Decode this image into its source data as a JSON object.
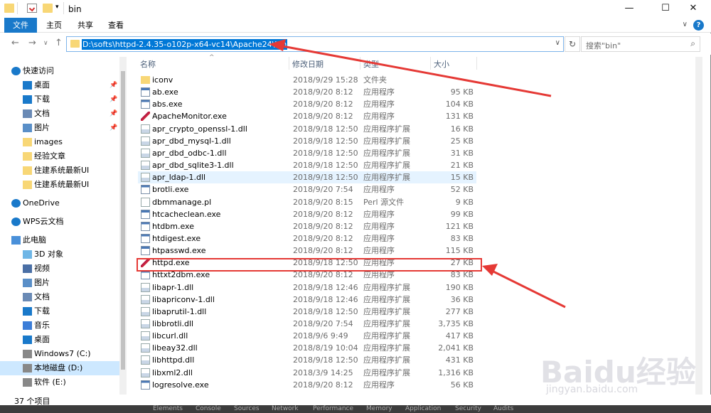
{
  "window": {
    "title": "bin"
  },
  "ribbon": {
    "tabs": [
      "文件",
      "主页",
      "共享",
      "查看"
    ]
  },
  "address": {
    "path": "D:\\softs\\httpd-2.4.35-o102p-x64-vc14\\Apache24\\bin",
    "search_placeholder": "搜索\"bin\""
  },
  "sidebar": {
    "items": [
      {
        "label": "快速访问",
        "icon": "star-icon",
        "pinned": false
      },
      {
        "label": "桌面",
        "icon": "desktop-icon",
        "pinned": true
      },
      {
        "label": "下载",
        "icon": "download-icon",
        "pinned": true
      },
      {
        "label": "文档",
        "icon": "document-icon",
        "pinned": true
      },
      {
        "label": "图片",
        "icon": "picture-icon",
        "pinned": true
      },
      {
        "label": "images",
        "icon": "folder-icon",
        "pinned": false
      },
      {
        "label": "经验文章",
        "icon": "folder-icon",
        "pinned": false
      },
      {
        "label": "住建系统最新UI",
        "icon": "folder-icon",
        "pinned": false
      },
      {
        "label": "住建系统最新UI",
        "icon": "folder-icon",
        "pinned": false
      },
      {
        "label": "OneDrive",
        "icon": "cloud-icon",
        "pinned": false
      },
      {
        "label": "WPS云文档",
        "icon": "cloud-icon",
        "pinned": false
      },
      {
        "label": "此电脑",
        "icon": "computer-icon",
        "pinned": false
      },
      {
        "label": "3D 对象",
        "icon": "cube-icon",
        "pinned": false
      },
      {
        "label": "视频",
        "icon": "video-icon",
        "pinned": false
      },
      {
        "label": "图片",
        "icon": "picture-icon",
        "pinned": false
      },
      {
        "label": "文档",
        "icon": "document-icon",
        "pinned": false
      },
      {
        "label": "下载",
        "icon": "download-icon",
        "pinned": false
      },
      {
        "label": "音乐",
        "icon": "music-icon",
        "pinned": false
      },
      {
        "label": "桌面",
        "icon": "desktop-icon",
        "pinned": false
      },
      {
        "label": "Windows7 (C:)",
        "icon": "drive-icon",
        "pinned": false
      },
      {
        "label": "本地磁盘 (D:)",
        "icon": "drive-icon",
        "pinned": false
      },
      {
        "label": "软件 (E:)",
        "icon": "drive-icon",
        "pinned": false
      }
    ]
  },
  "columns": {
    "name": "名称",
    "date": "修改日期",
    "type": "类型",
    "size": "大小"
  },
  "files": [
    {
      "name": "iconv",
      "date": "2018/9/29 15:28",
      "type": "文件夹",
      "size": "",
      "icon": "folder-icon"
    },
    {
      "name": "ab.exe",
      "date": "2018/9/20 8:12",
      "type": "应用程序",
      "size": "95 KB",
      "icon": "exe-icon"
    },
    {
      "name": "abs.exe",
      "date": "2018/9/20 8:12",
      "type": "应用程序",
      "size": "104 KB",
      "icon": "exe-icon"
    },
    {
      "name": "ApacheMonitor.exe",
      "date": "2018/9/20 8:12",
      "type": "应用程序",
      "size": "131 KB",
      "icon": "apache-feather-icon"
    },
    {
      "name": "apr_crypto_openssl-1.dll",
      "date": "2018/9/18 12:50",
      "type": "应用程序扩展",
      "size": "16 KB",
      "icon": "dll-icon"
    },
    {
      "name": "apr_dbd_mysql-1.dll",
      "date": "2018/9/18 12:50",
      "type": "应用程序扩展",
      "size": "25 KB",
      "icon": "dll-icon"
    },
    {
      "name": "apr_dbd_odbc-1.dll",
      "date": "2018/9/18 12:50",
      "type": "应用程序扩展",
      "size": "31 KB",
      "icon": "dll-icon"
    },
    {
      "name": "apr_dbd_sqlite3-1.dll",
      "date": "2018/9/18 12:50",
      "type": "应用程序扩展",
      "size": "21 KB",
      "icon": "dll-icon"
    },
    {
      "name": "apr_ldap-1.dll",
      "date": "2018/9/18 12:50",
      "type": "应用程序扩展",
      "size": "15 KB",
      "icon": "dll-icon"
    },
    {
      "name": "brotli.exe",
      "date": "2018/9/20 7:54",
      "type": "应用程序",
      "size": "52 KB",
      "icon": "exe-icon"
    },
    {
      "name": "dbmmanage.pl",
      "date": "2018/9/20 8:15",
      "type": "Perl 源文件",
      "size": "9 KB",
      "icon": "file-icon"
    },
    {
      "name": "htcacheclean.exe",
      "date": "2018/9/20 8:12",
      "type": "应用程序",
      "size": "99 KB",
      "icon": "exe-icon"
    },
    {
      "name": "htdbm.exe",
      "date": "2018/9/20 8:12",
      "type": "应用程序",
      "size": "121 KB",
      "icon": "exe-icon"
    },
    {
      "name": "htdigest.exe",
      "date": "2018/9/20 8:12",
      "type": "应用程序",
      "size": "83 KB",
      "icon": "exe-icon"
    },
    {
      "name": "htpasswd.exe",
      "date": "2018/9/20 8:12",
      "type": "应用程序",
      "size": "115 KB",
      "icon": "exe-icon"
    },
    {
      "name": "httpd.exe",
      "date": "2018/9/18 12:50",
      "type": "应用程序",
      "size": "27 KB",
      "icon": "apache-feather-icon"
    },
    {
      "name": "httxt2dbm.exe",
      "date": "2018/9/20 8:12",
      "type": "应用程序",
      "size": "83 KB",
      "icon": "exe-icon"
    },
    {
      "name": "libapr-1.dll",
      "date": "2018/9/18 12:46",
      "type": "应用程序扩展",
      "size": "190 KB",
      "icon": "dll-icon"
    },
    {
      "name": "libapriconv-1.dll",
      "date": "2018/9/18 12:46",
      "type": "应用程序扩展",
      "size": "36 KB",
      "icon": "dll-icon"
    },
    {
      "name": "libaprutil-1.dll",
      "date": "2018/9/18 12:50",
      "type": "应用程序扩展",
      "size": "277 KB",
      "icon": "dll-icon"
    },
    {
      "name": "libbrotli.dll",
      "date": "2018/9/20 7:54",
      "type": "应用程序扩展",
      "size": "3,735 KB",
      "icon": "dll-icon"
    },
    {
      "name": "libcurl.dll",
      "date": "2018/9/6 9:49",
      "type": "应用程序扩展",
      "size": "417 KB",
      "icon": "dll-icon"
    },
    {
      "name": "libeay32.dll",
      "date": "2018/8/19 10:04",
      "type": "应用程序扩展",
      "size": "2,041 KB",
      "icon": "dll-icon"
    },
    {
      "name": "libhttpd.dll",
      "date": "2018/9/18 12:50",
      "type": "应用程序扩展",
      "size": "431 KB",
      "icon": "dll-icon"
    },
    {
      "name": "libxml2.dll",
      "date": "2018/3/9 14:25",
      "type": "应用程序扩展",
      "size": "1,316 KB",
      "icon": "dll-icon"
    },
    {
      "name": "logresolve.exe",
      "date": "2018/9/20 8:12",
      "type": "应用程序",
      "size": "56 KB",
      "icon": "exe-icon"
    }
  ],
  "status": {
    "count": "37 个项目"
  },
  "devtools_tabs": [
    "Elements",
    "Console",
    "Sources",
    "Network",
    "Performance",
    "Memory",
    "Application",
    "Security",
    "Audits"
  ],
  "watermark": {
    "brand": "Baidu经验",
    "url": "jingyan.baidu.com"
  },
  "colors": {
    "accent": "#1979ca",
    "selection": "#0078d7",
    "highlight": "#e5f3ff",
    "annotation": "#e53935"
  }
}
